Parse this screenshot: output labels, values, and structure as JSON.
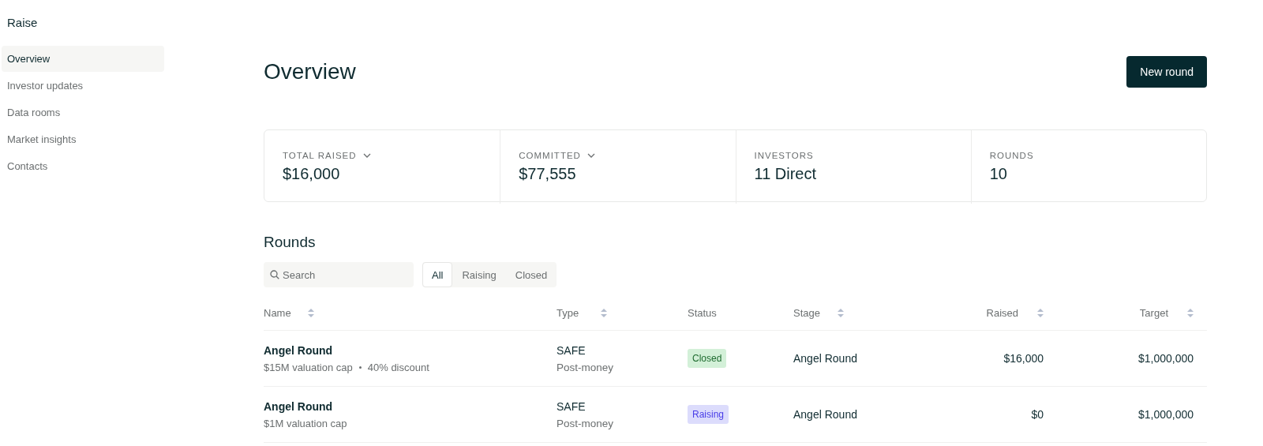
{
  "sidebar": {
    "brand": "Raise",
    "items": [
      {
        "label": "Overview",
        "selected": true
      },
      {
        "label": "Investor updates",
        "selected": false
      },
      {
        "label": "Data rooms",
        "selected": false
      },
      {
        "label": "Market insights",
        "selected": false
      },
      {
        "label": "Contacts",
        "selected": false
      }
    ]
  },
  "header": {
    "title": "Overview",
    "button": "New round"
  },
  "stats": [
    {
      "label": "TOTAL RAISED",
      "value": "$16,000",
      "dropdown": true
    },
    {
      "label": "COMMITTED",
      "value": "$77,555",
      "dropdown": true
    },
    {
      "label": "INVESTORS",
      "value": "11 Direct",
      "dropdown": false
    },
    {
      "label": "ROUNDS",
      "value": "10",
      "dropdown": false
    }
  ],
  "rounds": {
    "title": "Rounds",
    "search": {
      "placeholder": "Search"
    },
    "filters": [
      {
        "label": "All",
        "selected": true
      },
      {
        "label": "Raising",
        "selected": false
      },
      {
        "label": "Closed",
        "selected": false
      }
    ],
    "table": {
      "columns": [
        {
          "label": "Name",
          "sortable": true
        },
        {
          "label": "Type",
          "sortable": true
        },
        {
          "label": "Status",
          "sortable": false
        },
        {
          "label": "Stage",
          "sortable": true
        },
        {
          "label": "Raised",
          "sortable": true
        },
        {
          "label": "Target",
          "sortable": true
        }
      ],
      "rows": [
        {
          "name": "Angel Round",
          "terms": [
            "$15M valuation cap",
            "40% discount"
          ],
          "type": "SAFE",
          "subtype": "Post-money",
          "status": {
            "label": "Closed",
            "kind": "closed"
          },
          "stage": "Angel Round",
          "raised": "$16,000",
          "target": "$1,000,000"
        },
        {
          "name": "Angel Round",
          "terms": [
            "$1M valuation cap"
          ],
          "type": "SAFE",
          "subtype": "Post-money",
          "status": {
            "label": "Raising",
            "kind": "raising"
          },
          "stage": "Angel Round",
          "raised": "$0",
          "target": "$1,000,000"
        }
      ]
    }
  }
}
